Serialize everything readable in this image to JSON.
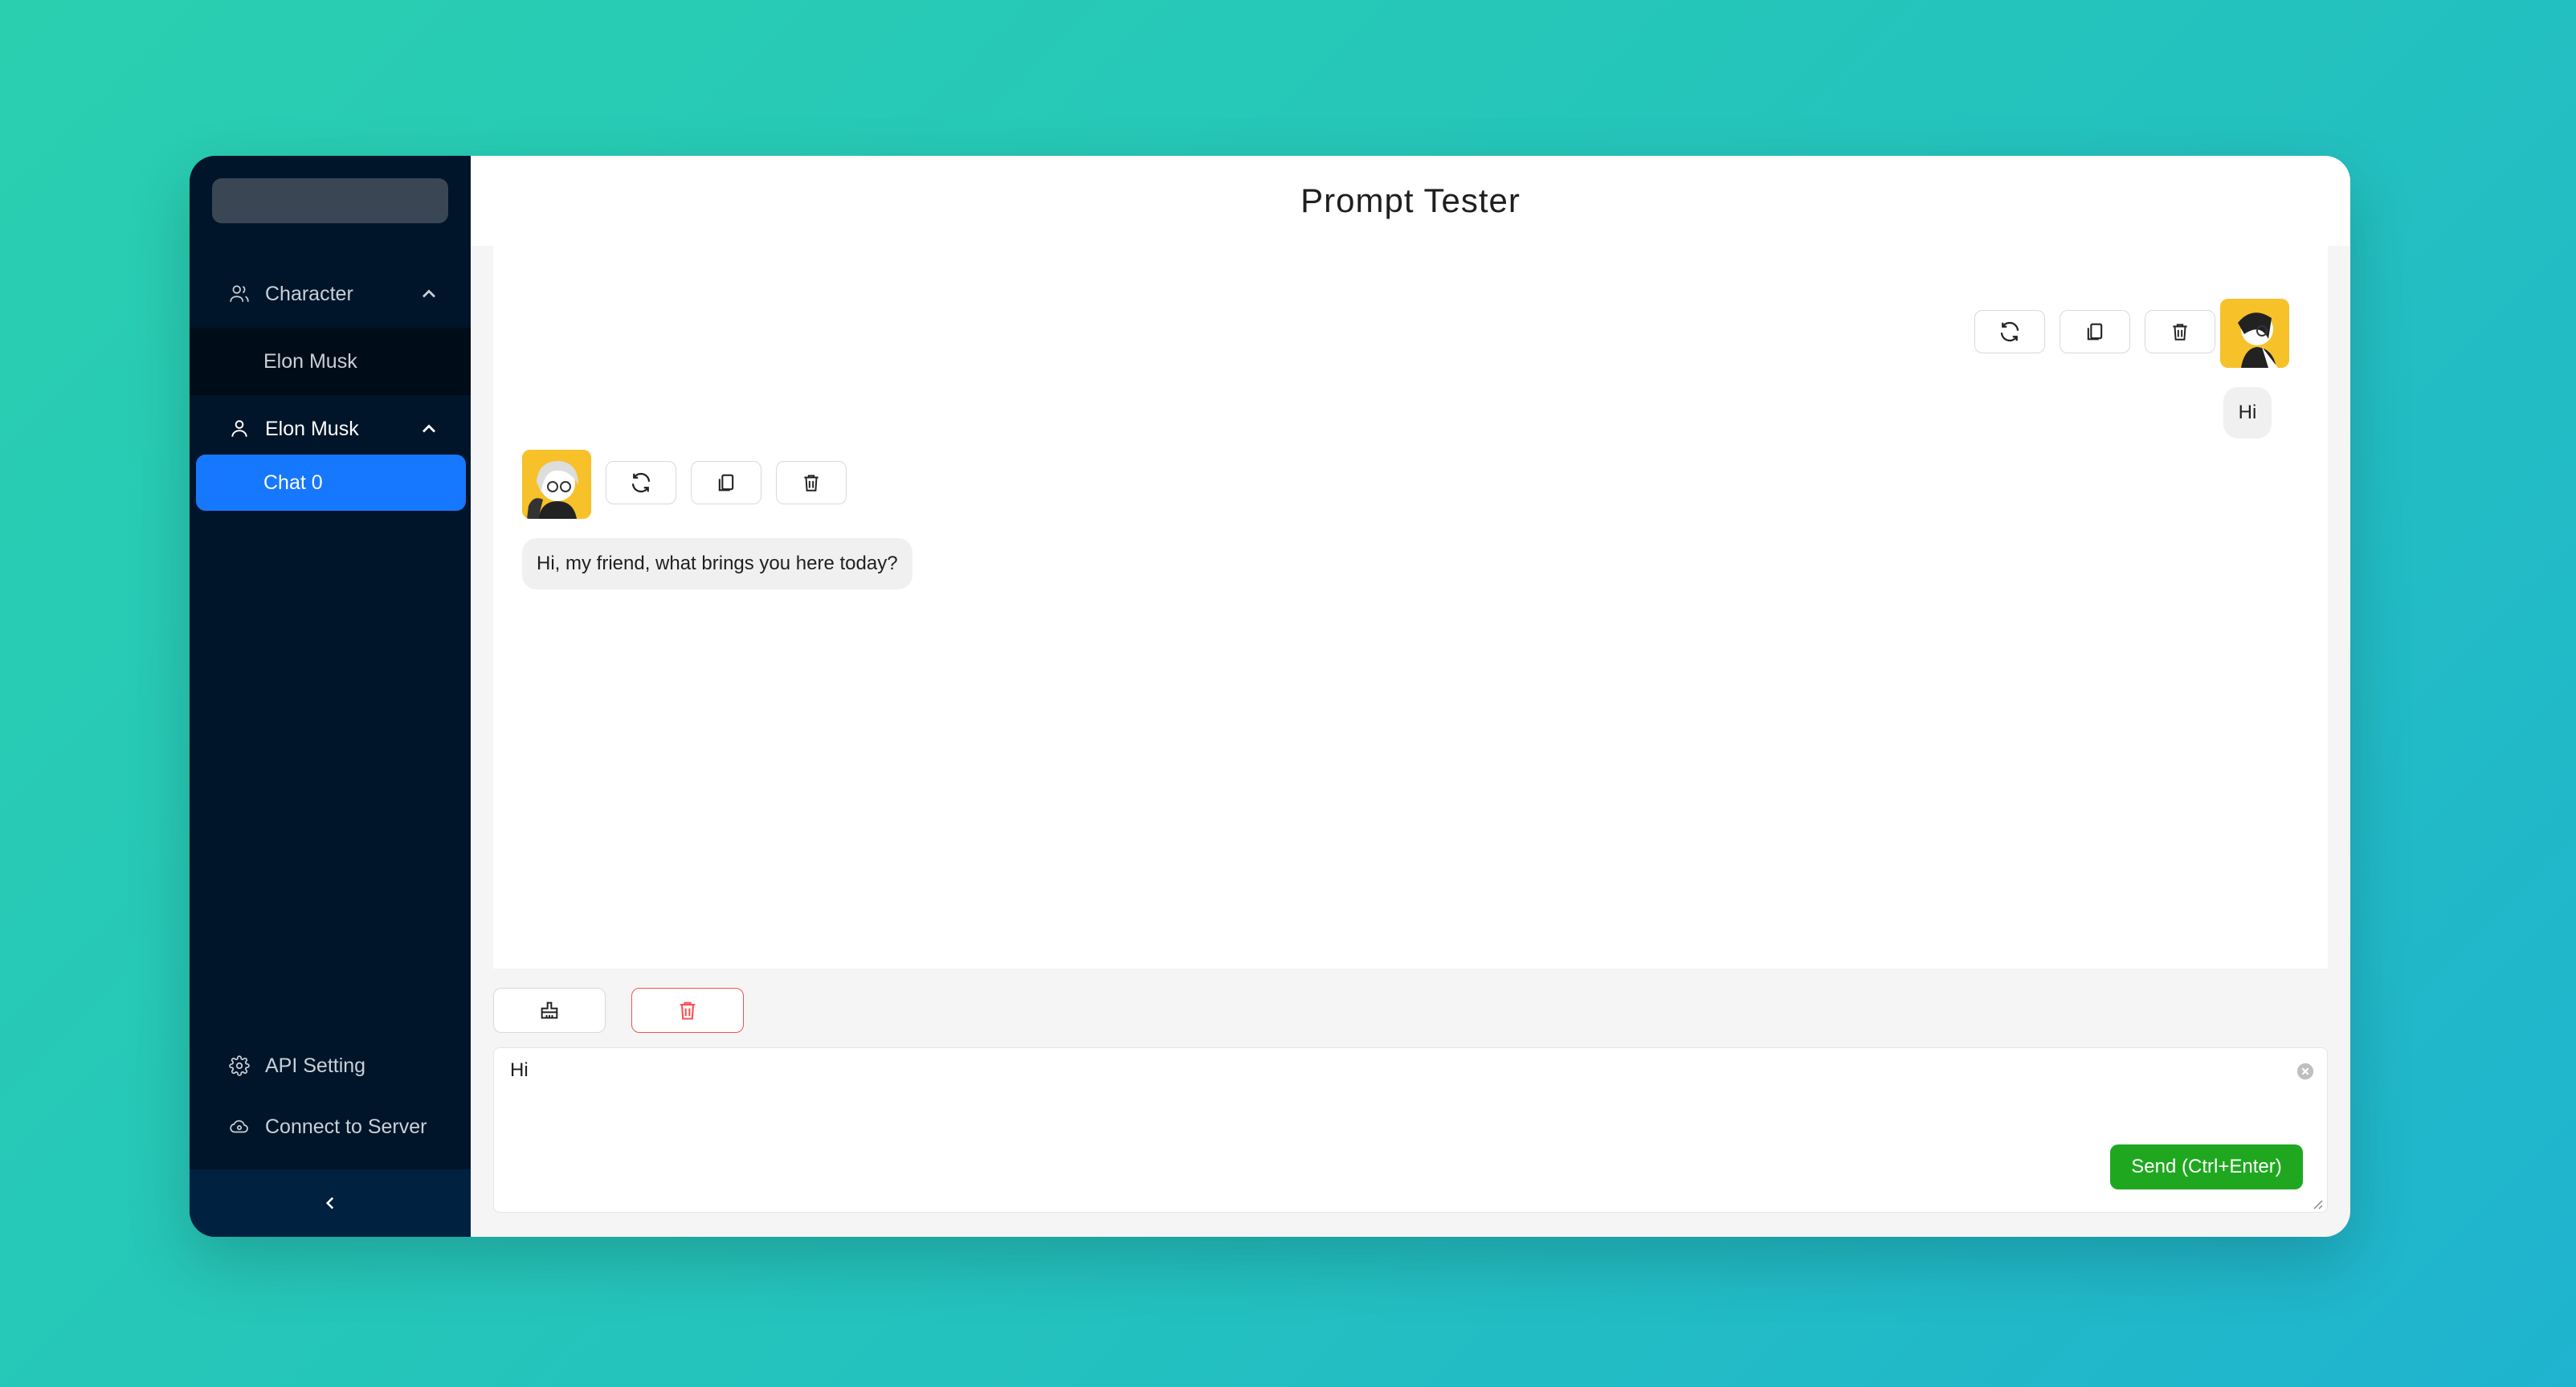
{
  "app": {
    "title": "Prompt Tester"
  },
  "sidebar": {
    "groups": [
      {
        "label": "Character",
        "icon": "users-icon",
        "expanded": true,
        "items": [
          {
            "label": "Elon Musk"
          }
        ]
      },
      {
        "label": "Elon Musk",
        "icon": "user-icon",
        "expanded": true,
        "items": [
          {
            "label": "Chat 0",
            "selected": true
          }
        ]
      }
    ],
    "bottom": [
      {
        "label": "API Setting",
        "icon": "gear-icon"
      },
      {
        "label": "Connect to Server",
        "icon": "cloud-icon"
      }
    ],
    "collapse_icon": "chevron-left-icon"
  },
  "chat": {
    "messages": [
      {
        "role": "user",
        "text": "Hi"
      },
      {
        "role": "assistant",
        "text": "Hi, my friend, what brings you here today?"
      }
    ],
    "message_actions": [
      "refresh-icon",
      "copy-icon",
      "delete-icon"
    ]
  },
  "composer": {
    "value": "Hi",
    "send_label": "Send (Ctrl+Enter)",
    "toolbar": [
      "broom-icon",
      "delete-icon"
    ]
  },
  "colors": {
    "sidebar_bg": "#001529",
    "selected_item": "#1677ff",
    "send_button": "#1fa81f",
    "danger": "#ff4d4f"
  }
}
